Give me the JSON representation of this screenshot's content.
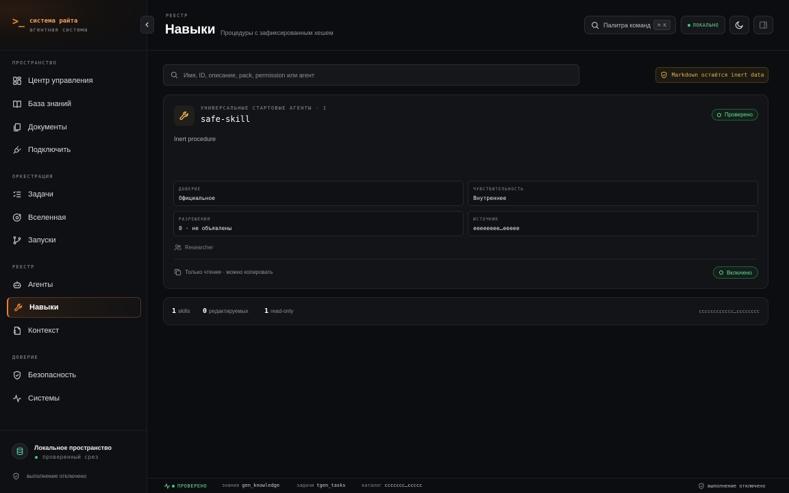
{
  "brand": {
    "prompt": ">_",
    "name": "система райта",
    "sub": "агентная система"
  },
  "sidebar": {
    "sections": [
      {
        "label": "ПРОСТРАНСТВО"
      },
      {
        "label": "ОРКЕСТРАЦИЯ"
      },
      {
        "label": "РЕЕСТР"
      },
      {
        "label": "ДОВЕРИЕ"
      }
    ],
    "items": [
      {
        "label": "Центр управления",
        "icon": "dashboard-icon"
      },
      {
        "label": "База знаний",
        "icon": "book-icon"
      },
      {
        "label": "Документы",
        "icon": "documents-icon"
      },
      {
        "label": "Подключить",
        "icon": "plug-icon"
      },
      {
        "label": "Задачи",
        "icon": "list-check-icon"
      },
      {
        "label": "Вселенная",
        "icon": "orbit-icon"
      },
      {
        "label": "Запуски",
        "icon": "branch-icon"
      },
      {
        "label": "Агенты",
        "icon": "bot-icon"
      },
      {
        "label": "Навыки",
        "icon": "wrench-icon",
        "active": true
      },
      {
        "label": "Контекст",
        "icon": "file-context-icon"
      },
      {
        "label": "Безопасность",
        "icon": "shield-check-icon"
      },
      {
        "label": "Системы",
        "icon": "activity-icon"
      }
    ],
    "workspace": {
      "title": "Локальное пространство",
      "status": "проверенный срез"
    },
    "execution": "выполнение отключено"
  },
  "header": {
    "crumb": "РЕЕСТР",
    "title": "Навыки",
    "subtitle": "Процедуры с зафиксированным хешем",
    "command_palette": "Палитра команд",
    "shortcut": "⌘ K",
    "mode": "ЛОКАЛЬНО"
  },
  "search": {
    "placeholder": "Имя, ID, описание, pack, permission или агент"
  },
  "inert_note": "Markdown остаётся inert data",
  "skill": {
    "kicker": "УНИВЕРСАЛЬНЫЕ СТАРТОВЫЕ АГЕНТЫ · 1",
    "name": "safe-skill",
    "status": "Проверено",
    "description": "Inert procedure",
    "meta": [
      {
        "key": "ДОВЕРИЕ",
        "value": "Официальное"
      },
      {
        "key": "ЧУВСТВИТЕЛЬНОСТЬ",
        "value": "Внутреннее"
      },
      {
        "key": "РАЗРЕШЕНИЯ",
        "value": "0 · не объявлены"
      },
      {
        "key": "ИСТОЧНИК",
        "value": "eeeeeeee…eeeee"
      }
    ],
    "role": "Researcher",
    "access": "Только чтение · можно копировать",
    "enabled": "Включено"
  },
  "summary": {
    "skills_count": "1",
    "skills_label": "skills",
    "editable_count": "0",
    "editable_label": "редактируемых",
    "readonly_count": "1",
    "readonly_label": "read-only",
    "hash": "cccccccccccc…cccccccc"
  },
  "footer": {
    "status": "ПРОВЕРЕНО",
    "knowledge_label": "знания",
    "knowledge_value": "gen_knowledge",
    "tasks_label": "задачи",
    "tasks_value": "tgen_tasks",
    "catalog_label": "каталог",
    "catalog_value": "ccccccc…ccccc",
    "execution": "выполнение отключено"
  },
  "colors": {
    "accent": "#e8803a",
    "ok": "#3fd17a",
    "warn": "#e0b05a",
    "bg": "#0c0d10"
  }
}
